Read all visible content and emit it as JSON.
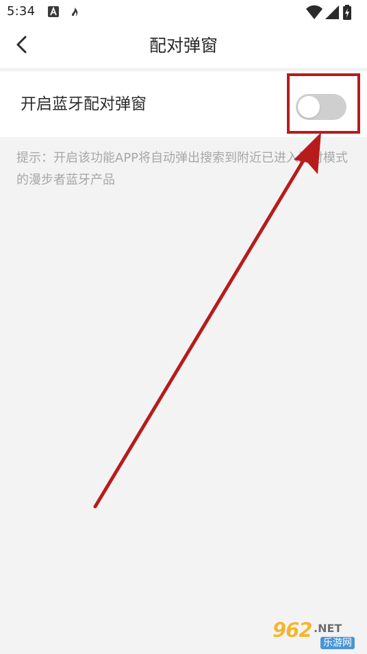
{
  "status_bar": {
    "time": "5:34",
    "left_icons": [
      "a-notification-icon",
      "flame-notification-icon"
    ],
    "right_icons": [
      "wifi-icon",
      "cellular-signal-icon",
      "battery-charging-icon"
    ]
  },
  "header": {
    "title": "配对弹窗",
    "back_icon": "chevron-left-icon"
  },
  "settings": {
    "row_label": "开启蓝牙配对弹窗",
    "toggle_on": false
  },
  "hint": {
    "text": "提示：开启该功能APP将自动弹出搜索到附近已进入配对模式的漫步者蓝牙产品"
  },
  "annotation": {
    "color": "#b81b1b"
  },
  "watermark": {
    "number": "962",
    "domain": ".NET",
    "cn": "乐游网"
  },
  "colors": {
    "background": "#f3f3f3",
    "toggle_off": "#cfcfcf",
    "hint_text": "#a7a7a7"
  }
}
